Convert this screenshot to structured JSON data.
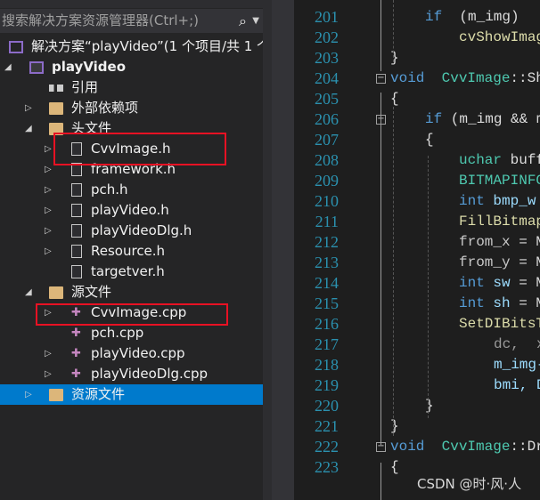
{
  "search": {
    "placeholder": "搜索解决方案资源管理器(Ctrl+;)",
    "icon": "search-icon"
  },
  "tree": {
    "solution": "解决方案“playVideo”(1 个项目/共 1 个",
    "project": "playVideo",
    "items": [
      {
        "label": "引用",
        "icon": "references-icon"
      },
      {
        "label": "外部依赖项",
        "icon": "folder-icon"
      },
      {
        "label": "头文件",
        "icon": "folder-open-icon"
      },
      {
        "label": "CvvImage.h",
        "icon": "header-file-icon"
      },
      {
        "label": "framework.h",
        "icon": "header-file-icon"
      },
      {
        "label": "pch.h",
        "icon": "header-file-icon"
      },
      {
        "label": "playVideo.h",
        "icon": "header-file-icon"
      },
      {
        "label": "playVideoDlg.h",
        "icon": "header-file-icon"
      },
      {
        "label": "Resource.h",
        "icon": "header-file-icon"
      },
      {
        "label": "targetver.h",
        "icon": "header-file-icon"
      },
      {
        "label": "源文件",
        "icon": "folder-open-icon"
      },
      {
        "label": "CvvImage.cpp",
        "icon": "cpp-file-icon"
      },
      {
        "label": "pch.cpp",
        "icon": "cpp-file-icon"
      },
      {
        "label": "playVideo.cpp",
        "icon": "cpp-file-icon"
      },
      {
        "label": "playVideoDlg.cpp",
        "icon": "cpp-file-icon"
      },
      {
        "label": "资源文件",
        "icon": "folder-icon",
        "selected": true
      }
    ]
  },
  "code": [
    {
      "n": "201",
      "t": [
        [
          "kw",
          "if"
        ],
        [
          "",
          "(m_img)"
        ]
      ]
    },
    {
      "n": "202",
      "t": [
        [
          "fn",
          "cvShowImag"
        ]
      ]
    },
    {
      "n": "203",
      "t": [
        [
          "",
          "}"
        ]
      ]
    },
    {
      "n": "204",
      "t": [
        [
          "kw",
          "void"
        ],
        [
          "ty",
          "  CvvImage"
        ],
        [
          "",
          "::Sh"
        ]
      ]
    },
    {
      "n": "205",
      "t": [
        [
          "",
          "{"
        ]
      ]
    },
    {
      "n": "206",
      "t": [
        [
          "kw",
          "if"
        ],
        [
          "",
          " (m_img && m"
        ]
      ]
    },
    {
      "n": "207",
      "t": [
        [
          "",
          "{"
        ]
      ]
    },
    {
      "n": "208",
      "t": [
        [
          "ty",
          "uchar"
        ],
        [
          "",
          " buff"
        ]
      ]
    },
    {
      "n": "209",
      "t": [
        [
          "ty",
          "BITMAPINFO"
        ]
      ]
    },
    {
      "n": "210",
      "t": [
        [
          "kw",
          "int"
        ],
        [
          "va",
          " bmp_w"
        ]
      ]
    },
    {
      "n": "211",
      "t": [
        [
          "fn",
          "FillBitmap"
        ]
      ]
    },
    {
      "n": "212",
      "t": [
        [
          "gr",
          "from_x"
        ],
        [
          "",
          " = M"
        ]
      ]
    },
    {
      "n": "213",
      "t": [
        [
          "gr",
          "from_y"
        ],
        [
          "",
          " = M"
        ]
      ]
    },
    {
      "n": "214",
      "t": [
        [
          "kw",
          "int"
        ],
        [
          "va",
          " sw"
        ],
        [
          "",
          " = M"
        ]
      ]
    },
    {
      "n": "215",
      "t": [
        [
          "kw",
          "int"
        ],
        [
          "va",
          " sh"
        ],
        [
          "",
          " = M"
        ]
      ]
    },
    {
      "n": "216",
      "t": [
        [
          "fn",
          "SetDIBitsT"
        ]
      ]
    },
    {
      "n": "217",
      "t": [
        [
          "pa",
          "dc,  x,"
        ]
      ]
    },
    {
      "n": "218",
      "t": [
        [
          "va",
          "m_img-"
        ]
      ]
    },
    {
      "n": "219",
      "t": [
        [
          "va",
          "bmi, D"
        ]
      ]
    },
    {
      "n": "220",
      "t": [
        [
          "",
          "}"
        ]
      ]
    },
    {
      "n": "221",
      "t": [
        [
          "",
          "}"
        ]
      ]
    },
    {
      "n": "222",
      "t": [
        [
          "kw",
          "void"
        ],
        [
          "ty",
          "  CvvImage"
        ],
        [
          "",
          "::Dr"
        ]
      ]
    },
    {
      "n": "223",
      "t": [
        [
          "",
          "{"
        ]
      ]
    }
  ],
  "watermark": "CSDN @时·风·人",
  "colors": {
    "selection": "#007acc",
    "highlight_box": "#e81123",
    "keyword": "#569cd6",
    "type": "#4ec9b0",
    "function": "#dcdcaa",
    "line_number": "#2b91af"
  }
}
